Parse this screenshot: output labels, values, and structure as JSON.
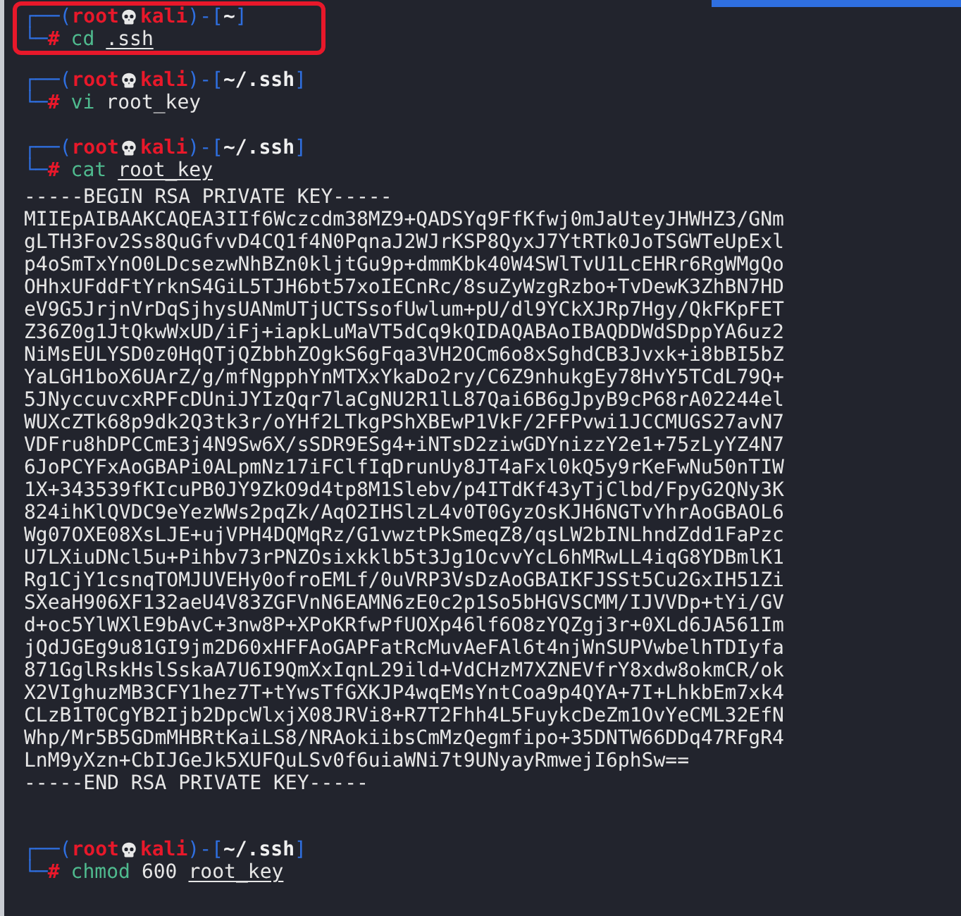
{
  "blocks": [
    {
      "kind": "command",
      "highlighted": true,
      "prompt": {
        "open": "┌──(",
        "user": "root",
        "host": "kali",
        "mid": ")-[",
        "path": "~",
        "close": "]",
        "corner": "└─",
        "symbol": "#"
      },
      "args": [
        {
          "text": "cd",
          "kind": "cmd"
        },
        {
          "text": ".ssh",
          "kind": "path"
        }
      ]
    },
    {
      "kind": "command",
      "highlighted": false,
      "prompt": {
        "open": "┌──(",
        "user": "root",
        "host": "kali",
        "mid": ")-[",
        "path": "~/.ssh",
        "close": "]",
        "corner": "└─",
        "symbol": "#"
      },
      "args": [
        {
          "text": "vi",
          "kind": "cmd"
        },
        {
          "text": "root_key",
          "kind": "plain"
        }
      ]
    },
    {
      "kind": "command",
      "highlighted": false,
      "prompt": {
        "open": "┌──(",
        "user": "root",
        "host": "kali",
        "mid": ")-[",
        "path": "~/.ssh",
        "close": "]",
        "corner": "└─",
        "symbol": "#"
      },
      "args": [
        {
          "text": "cat",
          "kind": "cmd"
        },
        {
          "text": "root_key",
          "kind": "path"
        }
      ]
    },
    {
      "kind": "output",
      "lines": [
        "-----BEGIN RSA PRIVATE KEY-----",
        "MIIEpAIBAAKCAQEA3IIf6Wczcdm38MZ9+QADSYq9FfKfwj0mJaUteyJHWHZ3/GNm",
        "gLTH3Fov2Ss8QuGfvvD4CQ1f4N0PqnaJ2WJrKSP8QyxJ7YtRTk0JoTSGWTeUpExl",
        "p4oSmTxYnO0LDcsezwNhBZn0kljtGu9p+dmmKbk40W4SWlTvU1LcEHRr6RgWMgQo",
        "OHhxUFddFtYrknS4GiL5TJH6bt57xoIECnRc/8suZyWzgRzbo+TvDewK3ZhBN7HD",
        "eV9G5JrjnVrDqSjhysUANmUTjUCTSsofUwlum+pU/dl9YCkXJRp7Hgy/QkFKpFET",
        "Z36Z0g1JtQkwWxUD/iFj+iapkLuMaVT5dCq9kQIDAQABAoIBAQDDWdSDppYA6uz2",
        "NiMsEULYSD0z0HqQTjQZbbhZOgkS6gFqa3VH2OCm6o8xSghdCB3Jvxk+i8bBI5bZ",
        "YaLGH1boX6UArZ/g/mfNgpphYnMTXxYkaDo2ry/C6Z9nhukgEy78HvY5TCdL79Q+",
        "5JNyccuvcxRPFcDUniJYIzQqr7laCgNU2R1lL87Qai6B6gJpyB9cP68rA02244el",
        "WUXcZTk68p9dk2Q3tk3r/oYHf2LTkgPShXBEwP1VkF/2FFPvwi1JCCMUGS27avN7",
        "VDFru8hDPCCmE3j4N9Sw6X/sSDR9ESg4+iNTsD2ziwGDYnizzY2e1+75zLyYZ4N7",
        "6JoPCYFxAoGBAPi0ALpmNz17iFClfIqDrunUy8JT4aFxl0kQ5y9rKeFwNu50nTIW",
        "1X+343539fKIcuPB0JY9ZkO9d4tp8M1Slebv/p4ITdKf43yTjClbd/FpyG2QNy3K",
        "824ihKlQVDC9eYezWWs2pqZk/AqO2IHSlzL4v0T0GyzOsKJH6NGTvYhrAoGBAOL6",
        "Wg07OXE08XsLJE+ujVPH4DQMqRz/G1vwztPkSmeqZ8/qsLW2bINLhndZdd1FaPzc",
        "U7LXiuDNcl5u+Pihbv73rPNZOsixkklb5t3Jg1OcvvYcL6hMRwLL4iqG8YDBmlK1",
        "Rg1CjY1csnqTOMJUVEHy0ofroEMLf/0uVRP3VsDzAoGBAIKFJSSt5Cu2GxIH51Zi",
        "SXeaH906XF132aeU4V83ZGFVnN6EAMN6zE0c2p1So5bHGVSCMM/IJVVDp+tYi/GV",
        "d+oc5YlWXlE9bAvC+3nw8P+XPoKRfwPfUOXp46lf6O8zYQZgj3r+0XLd6JA561Im",
        "jQdJGEg9u81GI9jm2D60xHFFAoGAPFatRcMuvAeFAl6t4njWnSUPVwbelhTDIyfa",
        "871GglRskHslSskaA7U6I9QmXxIqnL29ild+VdCHzM7XZNEVfrY8xdw8okmCR/ok",
        "X2VIghuzMB3CFY1hez7T+tYwsTfGXKJP4wqEMsYntCoa9p4QYA+7I+LhkbEm7xk4",
        "CLzB1T0CgYB2Ijb2DpcWlxjX08JRVi8+R7T2Fhh4L5FuykcDeZm1OvYeCML32EfN",
        "Whp/Mr5B5GDmMHBRtKaiLS8/NRAokiibsCmMzQegmfipo+35DNTW66DDq47RFgR4",
        "LnM9yXzn+CbIJGeJk5XUFQuLSv0f6uiaWNi7t9UNyayRmwejI6phSw==",
        "-----END RSA PRIVATE KEY-----"
      ]
    },
    {
      "kind": "command",
      "highlighted": false,
      "prompt": {
        "open": "┌──(",
        "user": "root",
        "host": "kali",
        "mid": ")-[",
        "path": "~/.ssh",
        "close": "]",
        "corner": "└─",
        "symbol": "#"
      },
      "args": [
        {
          "text": "chmod",
          "kind": "cmd"
        },
        {
          "text": "600",
          "kind": "plain"
        },
        {
          "text": "root_key",
          "kind": "path"
        }
      ]
    }
  ]
}
